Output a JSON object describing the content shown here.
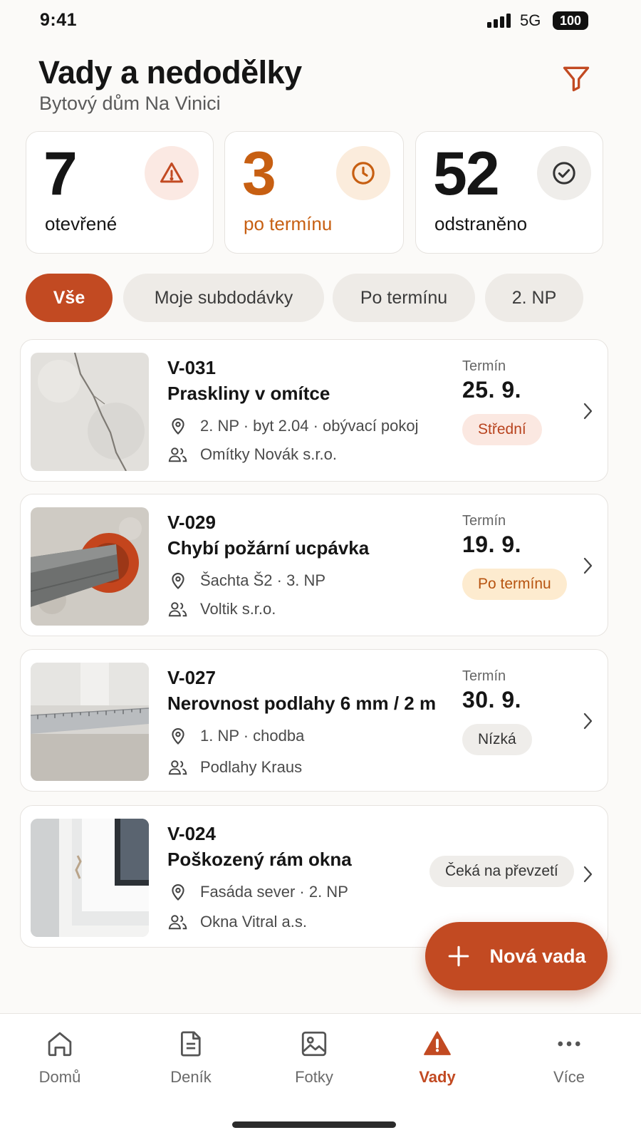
{
  "status_bar": {
    "time": "9:41",
    "network": "5G",
    "battery": "100"
  },
  "header": {
    "title": "Vady a nedodělky",
    "subtitle": "Bytový dům Na Vinici",
    "filter_icon": "filter-icon"
  },
  "stats": [
    {
      "value": "7",
      "label": "otevřené",
      "icon": "warning-icon",
      "color": "#151515",
      "icon_bg": "#fbe9e3",
      "icon_color": "#c24a22"
    },
    {
      "value": "3",
      "label": "po termínu",
      "icon": "clock-icon",
      "color": "#c75f12",
      "icon_bg": "#fbecdc",
      "icon_color": "#c75f12"
    },
    {
      "value": "52",
      "label": "odstraněno",
      "icon": "check-circle-icon",
      "color": "#151515",
      "icon_bg": "#efedea",
      "icon_color": "#333333"
    }
  ],
  "filters": [
    {
      "label": "Vše",
      "active": true
    },
    {
      "label": "Moje subdodávky",
      "active": false
    },
    {
      "label": "Po termínu",
      "active": false
    },
    {
      "label": "2. NP",
      "active": false
    }
  ],
  "defects": [
    {
      "id": "V-031",
      "title": "Praskliny v omítce",
      "location": "2. NP · byt 2.04 · obývací pokoj",
      "contractor": "Omítky Novák s.r.o.",
      "due_label": "Termín",
      "due_date": "25. 9.",
      "badge": "Střední",
      "badge_bg": "#fbe8e1",
      "badge_color": "#b8431e",
      "photo": "cracked-plaster"
    },
    {
      "id": "V-029",
      "title": "Chybí požární ucpávka",
      "location": "Šachta Š2 · 3. NP",
      "contractor": "Voltik s.r.o.",
      "due_label": "Termín",
      "due_date": "19. 9.",
      "badge": "Po termínu",
      "badge_bg": "#fdebcf",
      "badge_color": "#b75410",
      "photo": "pipe-penetration"
    },
    {
      "id": "V-027",
      "title": "Nerovnost podlahy 6 mm / 2 m",
      "location": "1. NP · chodba",
      "contractor": "Podlahy Kraus",
      "due_label": "Termín",
      "due_date": "30. 9.",
      "badge": "Nízká",
      "badge_bg": "#efedea",
      "badge_color": "#333333",
      "photo": "floor-level"
    },
    {
      "id": "V-024",
      "title": "Poškozený rám okna",
      "location": "Fasáda sever · 2. NP",
      "contractor": "Okna Vitral a.s.",
      "due_label": "",
      "due_date": "",
      "badge": "Čeká na převzetí",
      "badge_bg": "#efedea",
      "badge_color": "#333333",
      "photo": "window-frame"
    }
  ],
  "fab": {
    "label": "Nová vada",
    "icon": "plus-icon"
  },
  "tabs": [
    {
      "label": "Domů",
      "icon": "home-icon",
      "active": false
    },
    {
      "label": "Deník",
      "icon": "document-icon",
      "active": false
    },
    {
      "label": "Fotky",
      "icon": "photo-icon",
      "active": false
    },
    {
      "label": "Vady",
      "icon": "alert-icon",
      "active": true
    },
    {
      "label": "Více",
      "icon": "more-icon",
      "active": false
    }
  ],
  "colors": {
    "accent": "#c24a22",
    "overdue": "#c75f12"
  }
}
